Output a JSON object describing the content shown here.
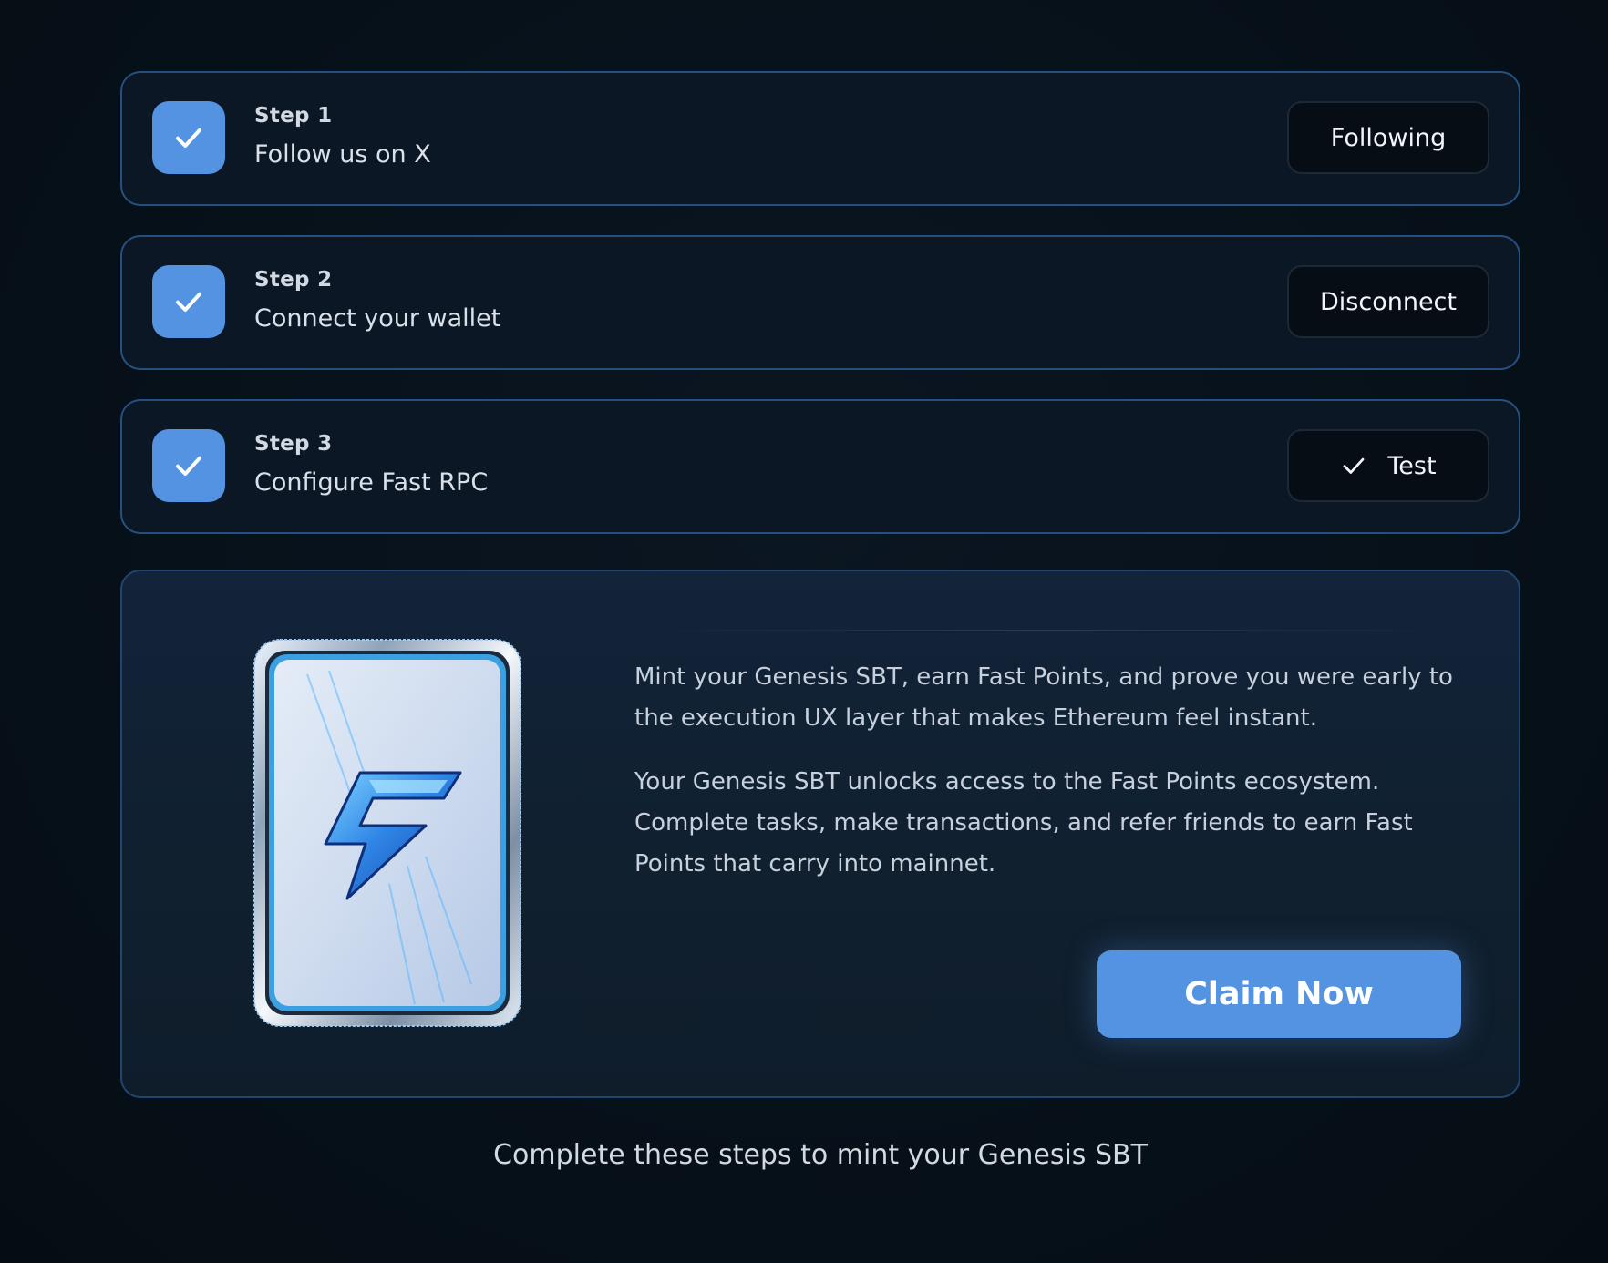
{
  "steps": [
    {
      "number_label": "Step 1",
      "title": "Follow us on X",
      "completed": true,
      "button_label": "Following",
      "button_icon": ""
    },
    {
      "number_label": "Step 2",
      "title": "Connect your wallet",
      "completed": true,
      "button_label": "Disconnect",
      "button_icon": ""
    },
    {
      "number_label": "Step 3",
      "title": "Configure Fast RPC",
      "completed": true,
      "button_label": "Test",
      "button_icon": "check-icon"
    }
  ],
  "claim": {
    "paragraph1": "Mint your Genesis SBT, earn Fast Points, and prove you were early to the execution UX layer that makes Ethereum feel instant.",
    "paragraph2": "Your Genesis SBT unlocks access to the Fast Points ecosystem. Complete tasks, make transactions, and refer friends to earn Fast Points that carry into mainnet.",
    "button_label": "Claim Now",
    "image_icon": "lightning-bolt-icon"
  },
  "footer": {
    "text": "Complete these steps to mint your Genesis SBT"
  },
  "colors": {
    "accent": "#5393e2",
    "background": "#07111a",
    "card_border": "#24507f",
    "card_background": "#0b1724"
  }
}
